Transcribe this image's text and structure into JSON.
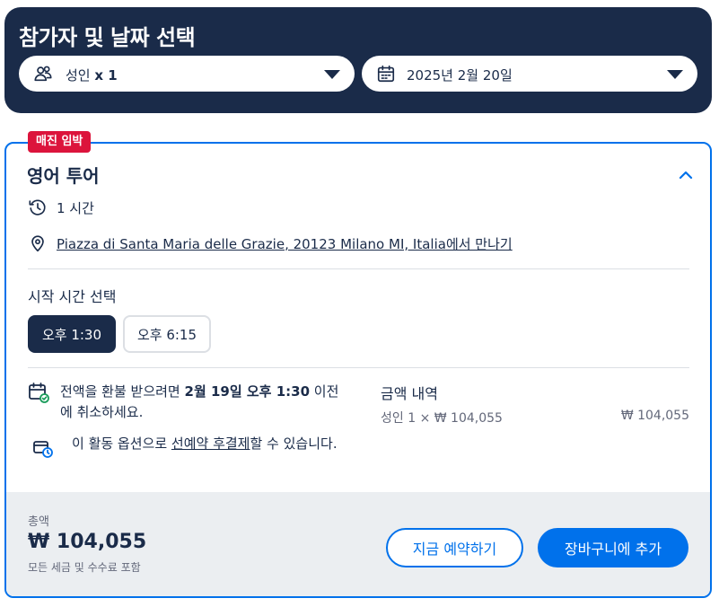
{
  "header": {
    "title": "참가자 및 날짜 선택",
    "participants": {
      "label": "성인",
      "count": "x 1",
      "icon": "people-icon"
    },
    "date": {
      "value": "2025년 2월 20일",
      "icon": "calendar-icon"
    }
  },
  "option": {
    "badge": "매진 임박",
    "title": "영어 투어",
    "duration": "1 시간",
    "meeting_point": {
      "address": "Piazza di Santa Maria delle Grazie, 20123 Milano MI, Italia",
      "suffix": "에서 만나기"
    },
    "start_time_label": "시작 시간 선택",
    "times": [
      {
        "label": "오후 1:30",
        "selected": true
      },
      {
        "label": "오후 6:15",
        "selected": false
      }
    ],
    "cancellation": {
      "pre": "전액을 환불 받으려면 ",
      "bold": "2월 19일 오후 1:30",
      "post": " 이전에 취소하세요."
    },
    "reserve_later": {
      "pre": "이 활동 옵션으로 ",
      "link": "선예약 후결제",
      "post": "할 수 있습니다."
    },
    "price_breakdown": {
      "heading": "금액 내역",
      "line_label": "성인 1 × ₩ 104,055",
      "line_value": "₩ 104,055"
    }
  },
  "footer": {
    "total_label": "총액",
    "total_value": "₩ 104,055",
    "total_note": "모든 세금 및 수수료 포함",
    "book_now": "지금 예약하기",
    "add_to_cart": "장바구니에 추가"
  },
  "colors": {
    "navy": "#1a2b49",
    "accent_blue": "#0071eb",
    "badge_red": "#dc143c",
    "footer_bg": "#ebeef1",
    "muted_text": "#63687a"
  }
}
